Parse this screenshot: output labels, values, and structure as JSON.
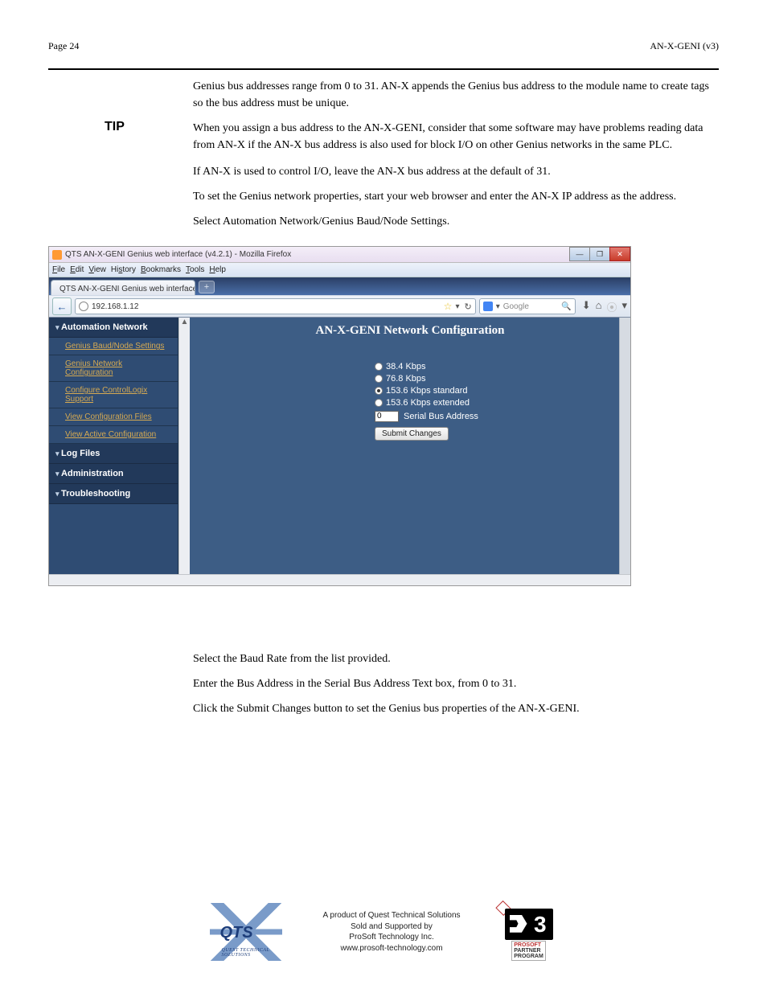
{
  "header": {
    "page_num": "Page 24",
    "doc_title": "AN-X-GENI (v3)"
  },
  "intro": {
    "p1": "Genius bus addresses range from 0 to 31. AN-X appends the Genius bus address to the module name to create tags so the bus address must be unique.",
    "tip_label": "TIP",
    "tip_text": "When you assign a bus address to the AN-X-GENI, consider that some software may have problems reading data from AN-X if the AN-X bus address is also used for block I/O on other Genius networks in the same PLC.",
    "p2": "If AN-X is used to control I/O, leave the AN-X bus address at the default of 31.",
    "p3": "To set the Genius network properties, start your web browser and enter the AN-X IP address as the address.",
    "p4": "Select Automation Network/Genius Baud/Node Settings."
  },
  "firefox": {
    "window_title": "QTS AN-X-GENI Genius web interface (v4.2.1) - Mozilla Firefox",
    "menus": [
      "File",
      "Edit",
      "View",
      "History",
      "Bookmarks",
      "Tools",
      "Help"
    ],
    "tab_title": "QTS AN-X-GENI Genius web interface (v...",
    "url": "192.168.1.12",
    "search_placeholder": "Google",
    "win_min": "—",
    "win_max": "❐",
    "win_close": "✕"
  },
  "webpage": {
    "sidebar": {
      "sections": [
        {
          "header": "Automation Network",
          "items": [
            "Genius Baud/Node Settings",
            "Genius Network Configuration",
            "Configure ControlLogix Support",
            "View Configuration Files",
            "View Active Configuration"
          ]
        },
        {
          "header": "Log Files",
          "items": []
        },
        {
          "header": "Administration",
          "items": []
        },
        {
          "header": "Troubleshooting",
          "items": []
        }
      ]
    },
    "main_title": "AN-X-GENI Network Configuration",
    "baud_options": [
      {
        "label": "38.4 Kbps",
        "selected": false
      },
      {
        "label": "76.8 Kbps",
        "selected": false
      },
      {
        "label": "153.6 Kbps standard",
        "selected": true
      },
      {
        "label": "153.6 Kbps extended",
        "selected": false
      }
    ],
    "sba_label": "Serial Bus Address",
    "sba_value": "0",
    "submit_label": "Submit Changes"
  },
  "instructions": {
    "p1": "Select the Baud Rate from the list provided.",
    "p2": "Enter the Bus Address in the Serial Bus Address Text box, from 0 to 31.",
    "p3": "Click the Submit Changes button to set the Genius bus properties of the AN-X-GENI."
  },
  "footer": {
    "line1": "A product of Quest Technical Solutions",
    "line2": "Sold and Supported by",
    "line3": "ProSoft Technology Inc.",
    "line4": "www.prosoft-technology.com",
    "qts_text": "QTS",
    "qts_sub": "QUEST TECHNICAL SOLUTIONS",
    "p3_l1": "PROSOFT",
    "p3_l2": "PARTNER",
    "p3_l3": "PROGRAM"
  }
}
